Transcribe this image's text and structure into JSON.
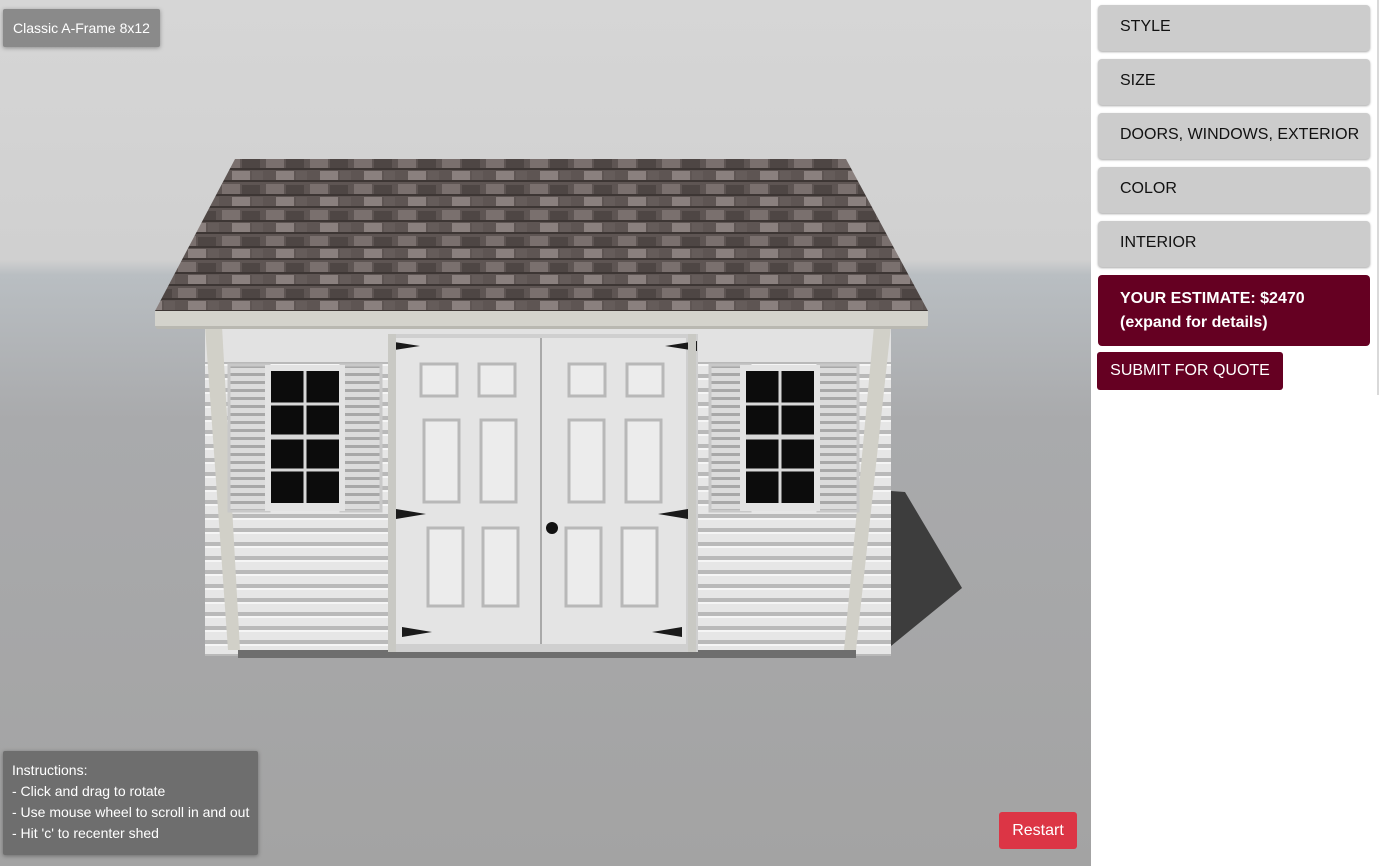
{
  "viewer": {
    "model_name": "Classic A-Frame 8x12",
    "instructions": [
      "Instructions:",
      "- Click and drag to rotate",
      "- Use mouse wheel to scroll in and out",
      "- Hit 'c' to recenter shed"
    ],
    "restart_label": "Restart"
  },
  "sidebar": {
    "menu": [
      {
        "label": "STYLE"
      },
      {
        "label": "SIZE"
      },
      {
        "label": "DOORS, WINDOWS, EXTERIOR"
      },
      {
        "label": "COLOR"
      },
      {
        "label": "INTERIOR"
      }
    ],
    "estimate_line1": "YOUR ESTIMATE: $2470",
    "estimate_line2": "(expand for details)",
    "submit_label": "SUBMIT FOR QUOTE"
  },
  "colors": {
    "accent": "#650022",
    "restart": "#dc3545",
    "menu_bg": "#cccccc"
  }
}
